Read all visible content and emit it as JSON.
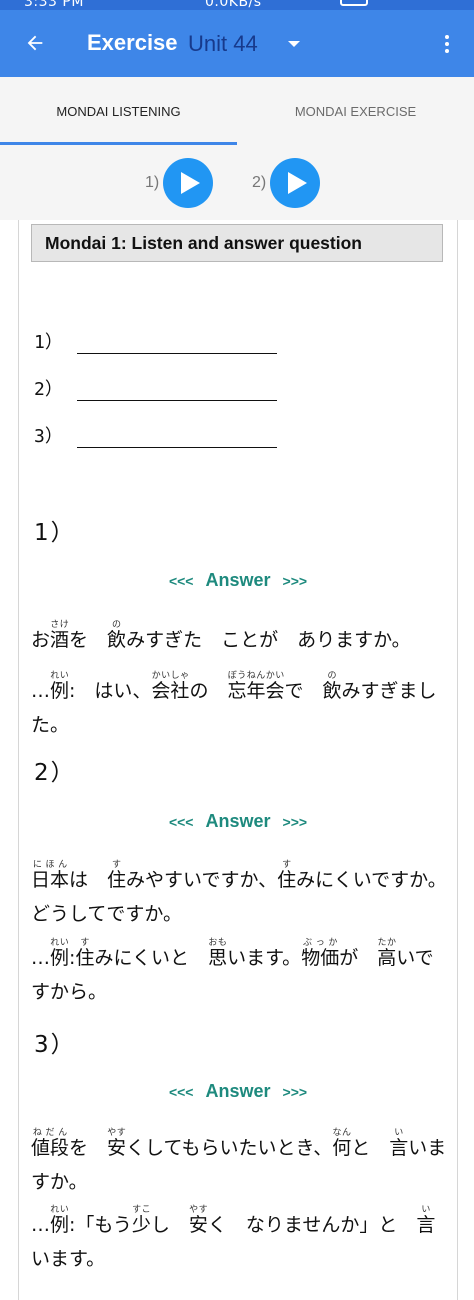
{
  "status": {
    "time": "3:33 PM",
    "speed": "0.0KB/s"
  },
  "appbar": {
    "title": "Exercise",
    "unit": "Unit 44"
  },
  "tabs": [
    {
      "label": "MONDAI LISTENING"
    },
    {
      "label": "MONDAI EXERCISE"
    }
  ],
  "players": [
    {
      "label": "1)"
    },
    {
      "label": "2)"
    }
  ],
  "mondai": {
    "header": "Mondai 1: Listen and answer question",
    "blanks": [
      "1）",
      "2）",
      "3）"
    ]
  },
  "questions": [
    {
      "num": "1）",
      "answer_left": "<<<",
      "answer_label": "Answer",
      "answer_right": ">>>"
    },
    {
      "num": "2）",
      "answer_left": "<<<",
      "answer_label": "Answer",
      "answer_right": ">>>"
    },
    {
      "num": "3）",
      "answer_left": "<<<",
      "answer_label": "Answer",
      "answer_right": ">>>"
    }
  ],
  "texts": {
    "q1_question": "お酒を　飲みすぎた　ことが　ありますか。",
    "q1_answer": "…例:　はい、会社の　忘年会で　飲みすぎました。",
    "q2_question": "日本は　住みやすいですか、住みにくいですか。どうしてですか。",
    "q2_answer": "…例:住みにくいと　思います。物価が　高いですから。",
    "q3_question": "値段を　安くしてもらいたいとき、何と　言いますか。",
    "q3_answer": "…例:「もう少し　安く　なりませんか」と　言います。"
  }
}
